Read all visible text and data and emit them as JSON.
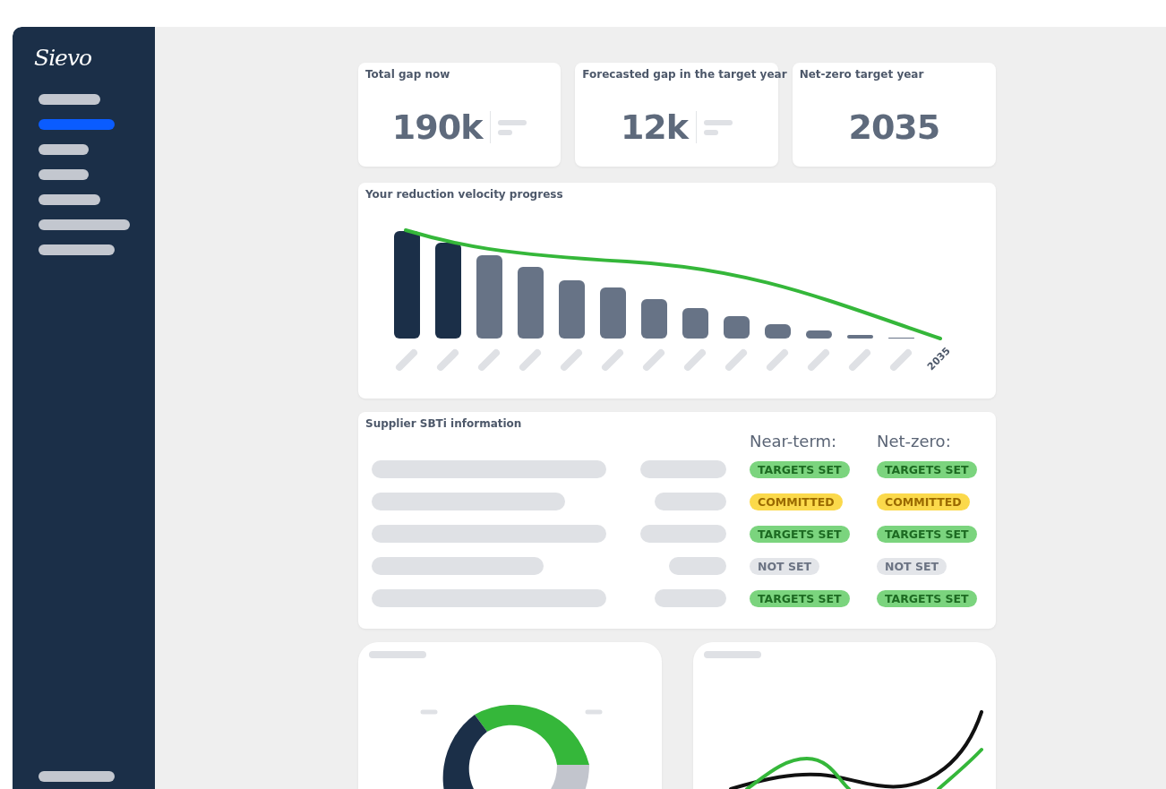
{
  "sidebar": {
    "logo": "Sievo",
    "items": [
      {
        "selected": false
      },
      {
        "selected": true
      },
      {
        "selected": false
      },
      {
        "selected": false
      },
      {
        "selected": false
      },
      {
        "selected": false
      },
      {
        "selected": false
      }
    ],
    "footer_item": {
      "selected": false
    }
  },
  "kpis": [
    {
      "title": "Total gap now",
      "value": "190k",
      "detail": true
    },
    {
      "title": "Forecasted gap in the target year",
      "value": "12k",
      "detail": true
    },
    {
      "title": "Net-zero target year",
      "value": "2035",
      "detail": false
    }
  ],
  "velocity": {
    "title": "Your reduction velocity progress",
    "end_label": "2035"
  },
  "sbti": {
    "title": "Supplier SBTi information",
    "columns": [
      "Near-term:",
      "Net-zero:"
    ],
    "rows": [
      {
        "near_term": {
          "label": "TARGETS SET",
          "kind": "set"
        },
        "net_zero": {
          "label": "TARGETS SET",
          "kind": "set"
        }
      },
      {
        "near_term": {
          "label": "COMMITTED",
          "kind": "committed"
        },
        "net_zero": {
          "label": "COMMITTED",
          "kind": "committed"
        }
      },
      {
        "near_term": {
          "label": "TARGETS SET",
          "kind": "set"
        },
        "net_zero": {
          "label": "TARGETS SET",
          "kind": "set"
        }
      },
      {
        "near_term": {
          "label": "NOT SET",
          "kind": "none"
        },
        "net_zero": {
          "label": "NOT SET",
          "kind": "none"
        }
      },
      {
        "near_term": {
          "label": "TARGETS SET",
          "kind": "set"
        },
        "net_zero": {
          "label": "TARGETS SET",
          "kind": "set"
        }
      }
    ]
  }
}
